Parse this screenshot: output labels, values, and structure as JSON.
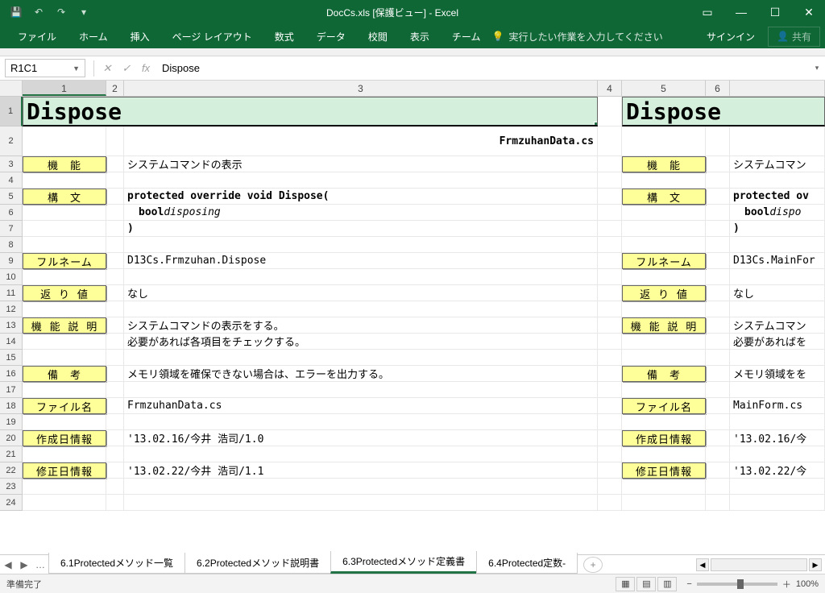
{
  "title": "DocCs.xls [保護ビュー] - Excel",
  "qat": {
    "save": "💾",
    "undo": "↶",
    "redo": "↷"
  },
  "win": {
    "ribbopt": "▭",
    "min": "—",
    "max": "☐",
    "close": "✕"
  },
  "ribbon": {
    "tabs": [
      "ファイル",
      "ホーム",
      "挿入",
      "ページ レイアウト",
      "数式",
      "データ",
      "校閲",
      "表示",
      "チーム"
    ],
    "tell_placeholder": "実行したい作業を入力してください",
    "signin": "サインイン",
    "share": "共有"
  },
  "namebox": "R1C1",
  "formula": "Dispose",
  "cols": [
    "1",
    "2",
    "3",
    "4",
    "5",
    "6",
    ""
  ],
  "rows_h": [
    "1",
    "2",
    "3",
    "4",
    "5",
    "6",
    "7",
    "8",
    "9",
    "10",
    "11",
    "12",
    "13",
    "14",
    "15",
    "16",
    "17",
    "18",
    "19",
    "20",
    "21",
    "22",
    "23",
    "24"
  ],
  "doc": {
    "title1": "Dispose",
    "title2": "Dispose",
    "file_hdr": "FrmzuhanData.cs",
    "labels": {
      "func": "機　能",
      "syntax": "構　文",
      "fullname": "フルネーム",
      "ret": "返 り 値",
      "desc": "機 能 説 明",
      "note": "備　考",
      "filename": "ファイル名",
      "created": "作成日情報",
      "modified": "修正日情報"
    },
    "left": {
      "func": "システムコマンドの表示",
      "sig1": "protected override void Dispose(",
      "sig2": " bool ",
      "sig2i": "disposing",
      "sig3": ")",
      "fullname": "D13Cs.Frmzuhan.Dispose",
      "ret": "なし",
      "desc1": "システムコマンドの表示をする。",
      "desc2": "必要があれば各項目をチェックする。",
      "note": "メモリ領域を確保できない場合は、エラーを出力する。",
      "filename": "FrmzuhanData.cs",
      "created": "'13.02.16/今井 浩司/1.0",
      "modified": "'13.02.22/今井 浩司/1.1"
    },
    "right": {
      "func": "システムコマン",
      "sig1": "protected ov",
      "sig2": " bool ",
      "sig2i": "dispo",
      "sig3": ")",
      "fullname": "D13Cs.MainFor",
      "ret": "なし",
      "desc1": "システムコマン",
      "desc2": "必要があればを",
      "note": "メモリ領域をを",
      "filename": "MainForm.cs",
      "created": "'13.02.16/今",
      "modified": "'13.02.22/今"
    }
  },
  "sheets": {
    "items": [
      {
        "label": "6.1Protectedメソッド一覧",
        "active": false
      },
      {
        "label": "6.2Protectedメソッド説明書",
        "active": false
      },
      {
        "label": "6.3Protectedメソッド定義書",
        "active": true
      },
      {
        "label": "6.4Protected定数-",
        "active": false
      }
    ],
    "ellipsis": "…"
  },
  "status": {
    "ready": "準備完了",
    "zoom": "100%"
  }
}
